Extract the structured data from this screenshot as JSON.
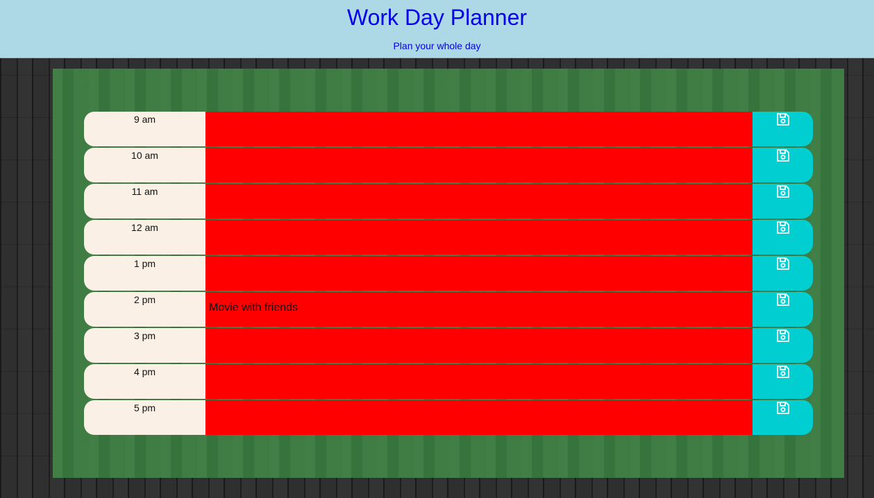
{
  "header": {
    "title": "Work Day Planner",
    "subtitle": "Plan your whole day"
  },
  "colors": {
    "header_bg": "#add8e6",
    "title_color": "#0000ee",
    "board_bg": "#3a7a40",
    "hour_bg": "#faf0e6",
    "past_present_task_bg": "#ff0000",
    "save_bg": "#00ced1"
  },
  "save_icon": "floppy-disk-icon",
  "timeblocks": [
    {
      "hour": "9 am",
      "task": ""
    },
    {
      "hour": "10 am",
      "task": ""
    },
    {
      "hour": "11 am",
      "task": ""
    },
    {
      "hour": "12 am",
      "task": ""
    },
    {
      "hour": "1 pm",
      "task": ""
    },
    {
      "hour": "2 pm",
      "task": "Movie with friends"
    },
    {
      "hour": "3 pm",
      "task": ""
    },
    {
      "hour": "4 pm",
      "task": ""
    },
    {
      "hour": "5 pm",
      "task": ""
    }
  ]
}
